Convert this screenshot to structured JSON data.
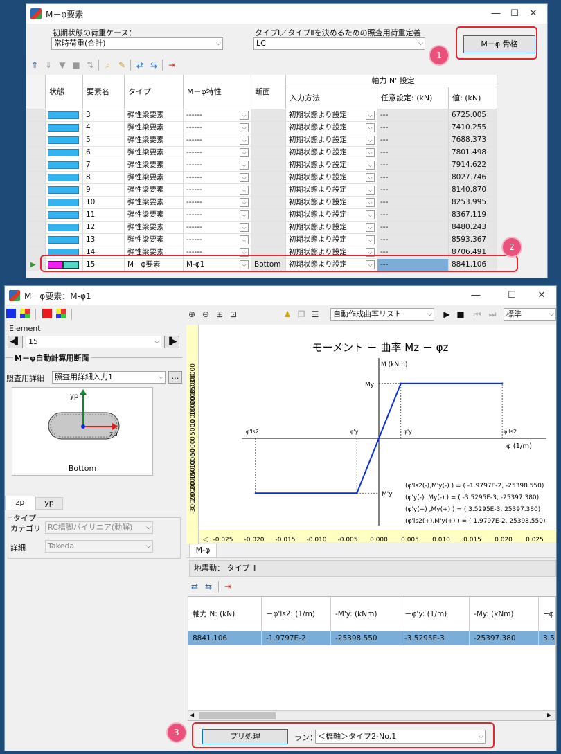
{
  "win1": {
    "title": "M－φ要素",
    "initial_case_label": "初期状態の荷重ケース：",
    "initial_case_value": "常時荷重(合計)",
    "type_label": "タイプⅠ／タイプⅡを決めるための照査用荷重定義",
    "type_value": "LC",
    "skeleton_button": "M－φ 骨格",
    "badge1": "1",
    "badge2": "2",
    "headers": {
      "state": "状態",
      "name": "要素名",
      "type": "タイプ",
      "mphi": "M－φ特性",
      "section": "断面",
      "axial_group": "軸力 N' 設定",
      "input_method": "入力方法",
      "optional": "任意設定: (kN)",
      "value": "値: (kN)"
    },
    "rows": [
      {
        "name": "3",
        "type": "弾性梁要素",
        "mphi": "------",
        "section": "",
        "method": "初期状態より設定",
        "opt": "---",
        "val": "6725.005"
      },
      {
        "name": "4",
        "type": "弾性梁要素",
        "mphi": "------",
        "section": "",
        "method": "初期状態より設定",
        "opt": "---",
        "val": "7410.255"
      },
      {
        "name": "5",
        "type": "弾性梁要素",
        "mphi": "------",
        "section": "",
        "method": "初期状態より設定",
        "opt": "---",
        "val": "7688.373"
      },
      {
        "name": "6",
        "type": "弾性梁要素",
        "mphi": "------",
        "section": "",
        "method": "初期状態より設定",
        "opt": "---",
        "val": "7801.498"
      },
      {
        "name": "7",
        "type": "弾性梁要素",
        "mphi": "------",
        "section": "",
        "method": "初期状態より設定",
        "opt": "---",
        "val": "7914.622"
      },
      {
        "name": "8",
        "type": "弾性梁要素",
        "mphi": "------",
        "section": "",
        "method": "初期状態より設定",
        "opt": "---",
        "val": "8027.746"
      },
      {
        "name": "9",
        "type": "弾性梁要素",
        "mphi": "------",
        "section": "",
        "method": "初期状態より設定",
        "opt": "---",
        "val": "8140.870"
      },
      {
        "name": "10",
        "type": "弾性梁要素",
        "mphi": "------",
        "section": "",
        "method": "初期状態より設定",
        "opt": "---",
        "val": "8253.995"
      },
      {
        "name": "11",
        "type": "弾性梁要素",
        "mphi": "------",
        "section": "",
        "method": "初期状態より設定",
        "opt": "---",
        "val": "8367.119"
      },
      {
        "name": "12",
        "type": "弾性梁要素",
        "mphi": "------",
        "section": "",
        "method": "初期状態より設定",
        "opt": "---",
        "val": "8480.243"
      },
      {
        "name": "13",
        "type": "弾性梁要素",
        "mphi": "------",
        "section": "",
        "method": "初期状態より設定",
        "opt": "---",
        "val": "8593.367"
      },
      {
        "name": "14",
        "type": "弾性梁要素",
        "mphi": "------",
        "section": "",
        "method": "初期状態より設定",
        "opt": "---",
        "val": "8706.491"
      },
      {
        "name": "15",
        "type": "M－φ要素",
        "mphi": "M-φ1",
        "section": "Bottom",
        "method": "初期状態より設定",
        "opt": "---",
        "val": "8841.106"
      }
    ]
  },
  "win2": {
    "title": "M－φ要素：M-φ1",
    "element_label": "Element",
    "element_value": "15",
    "section_heading": "M－φ自動計算用断面",
    "detail_label": "照査用詳細",
    "detail_value": "照査用詳細入力1",
    "ellipsis": "...",
    "section_label": "Bottom",
    "axis_yp": "yp",
    "axis_zp": "zp",
    "tab_zp": "zp",
    "tab_yp": "yp",
    "type_group": "タイプ",
    "category_label": "カテゴリ",
    "category_value": "RC橋脚バイリニア(動解)",
    "detail2_label": "詳細",
    "detail2_value": "Takeda",
    "curve_list": "自動作成曲率リスト",
    "standard": "標準",
    "tab_mphi": "M-φ",
    "seismic_label": "地震動：",
    "seismic_value": "タイプ Ⅱ",
    "table_headers": [
      "軸力 N: (kN)",
      "－φ'ls2: (1/m)",
      "-M'y: (kNm)",
      "－φ'y: (1/m)",
      "-My: (kNm)",
      "+φ"
    ],
    "table_row": [
      "8841.106",
      "-1.9797E-2",
      "-25398.550",
      "-3.5295E-3",
      "-25397.380",
      "3.5"
    ],
    "preprocess_button": "プリ処理",
    "run_label": "ラン：",
    "run_value": "＜橋軸＞タイプ2-No.1",
    "badge3": "3"
  },
  "chart_data": {
    "type": "line",
    "title": "モーメント － 曲率 Mz － φz",
    "xlabel": "φ (1/m)",
    "ylabel": "M (kNm)",
    "xlim": [
      -0.025,
      0.03
    ],
    "ylim": [
      -30000,
      30000
    ],
    "x_ticks": [
      "-0.025",
      "-0.020",
      "-0.015",
      "-0.010",
      "-0.005",
      "0.000",
      "0.005",
      "0.010",
      "0.015",
      "0.020",
      "0.025",
      "0"
    ],
    "y_ticks": [
      "30000",
      "25000",
      "20000",
      "15000",
      "10000",
      "5000",
      "0",
      "-5000",
      "-10000",
      "-15000",
      "-20000",
      "-25000",
      "-30000"
    ],
    "series": [
      {
        "x": [
          -0.019797,
          -0.0035295,
          0.0035295,
          0.019797
        ],
        "y": [
          -25398.55,
          -25397.38,
          25397.38,
          25398.55
        ]
      }
    ],
    "annotations": {
      "My": "My",
      "Mpy": "M'y",
      "phi_ls2_neg": "φ'ls2",
      "phi_y_neg": "φ'y",
      "phi_y_pos": "φ'y",
      "phi_ls2_pos": "φ'ls2"
    },
    "legend_lines": [
      "(φ'ls2(-),M'y(-) ) = ( -1.9797E-2,  -25398.550)",
      "(φ'y(-)  ,My(-) ) = ( -3.5295E-3,  -25397.380)",
      "(φ'y(+)  ,My(+) ) = (  3.5295E-3,   25397.380)",
      "(φ'ls2(+),M'y(+) ) = (  1.9797E-2,   25398.550)"
    ],
    "colors": {
      "line": "#0a2ee0",
      "axis_bg": "#ffffc4"
    }
  }
}
